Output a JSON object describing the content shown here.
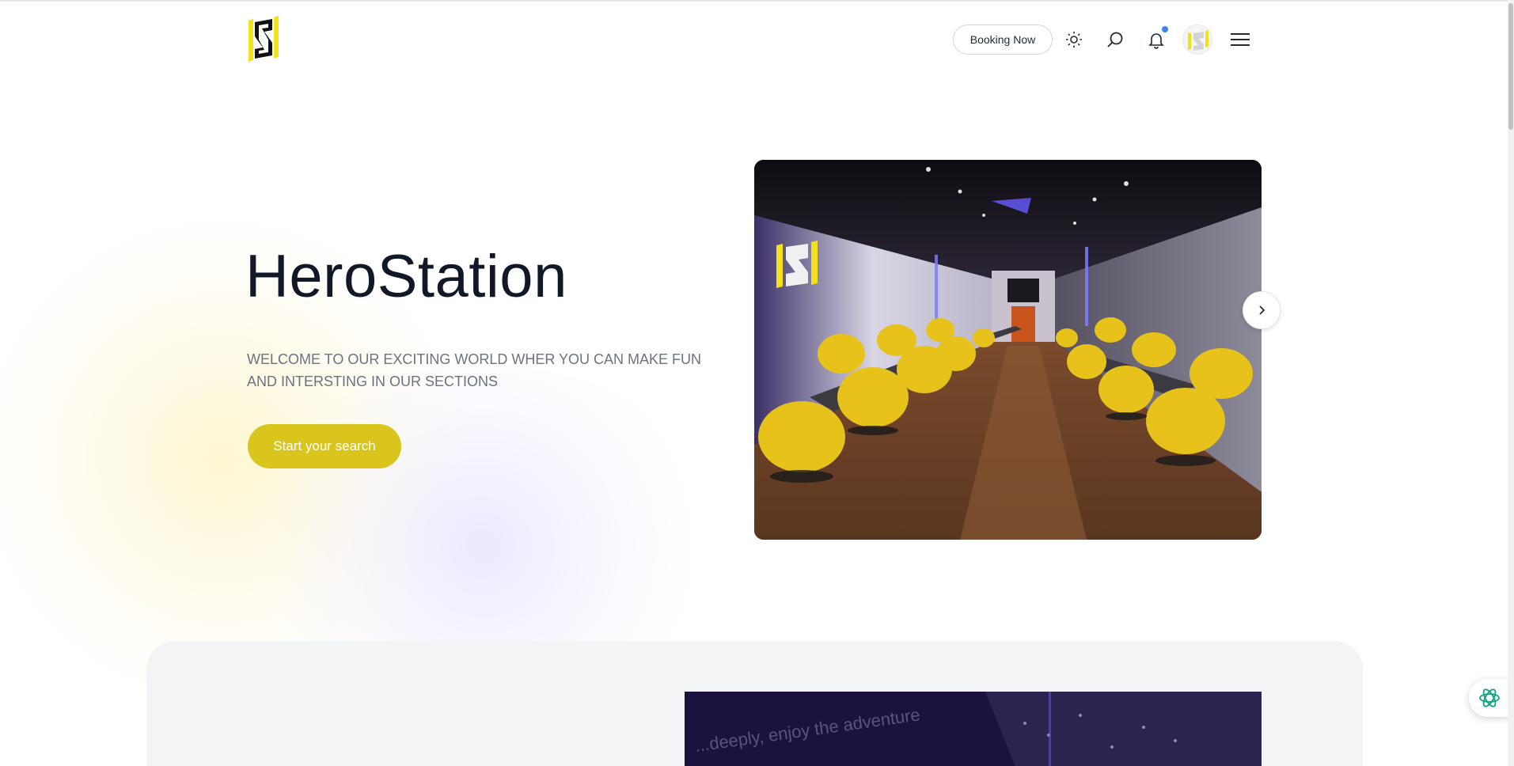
{
  "header": {
    "logo_letter": "S",
    "booking_label": "Booking Now",
    "icons": [
      "sun-icon",
      "search-icon",
      "bell-icon",
      "avatar",
      "menu-icon"
    ]
  },
  "hero": {
    "title": "HeroStation",
    "subtitle": "WELCOME TO OUR EXCITING WORLD WHER YOU CAN MAKE FUN AND INTERSTING IN OUR SECTIONS",
    "cta_label": "Start your search",
    "image_logo_letter": "S"
  },
  "section2": {
    "image_text": "...deeply, enjoy the adventure"
  },
  "colors": {
    "accent": "#d9c51b",
    "logo_yellow": "#f2e21c",
    "text_dark": "#111827",
    "text_muted": "#6b7280",
    "notification": "#3b82f6",
    "panel_bg": "#f3f4f6"
  }
}
